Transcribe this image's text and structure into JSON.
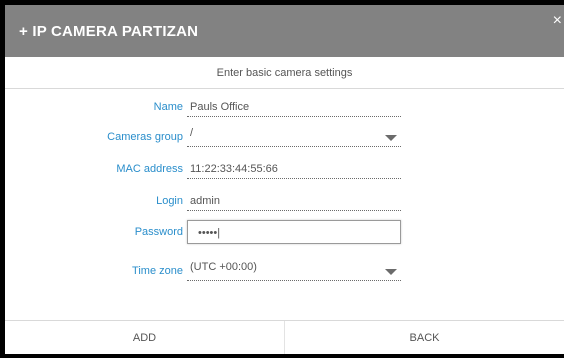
{
  "dialog": {
    "title": "+ IP CAMERA PARTIZAN",
    "subtitle": "Enter basic camera settings",
    "close_icon": "×"
  },
  "fields": {
    "name": {
      "label": "Name",
      "value": "Pauls Office"
    },
    "cameras_group": {
      "label": "Cameras group",
      "value": "/"
    },
    "mac_address": {
      "label": "MAC address",
      "value": "11:22:33:44:55:66"
    },
    "login": {
      "label": "Login",
      "value": "admin"
    },
    "password": {
      "label": "Password",
      "value": "•••••|"
    },
    "time_zone": {
      "label": "Time zone",
      "value": "(UTC +00:00)"
    }
  },
  "footer": {
    "add_label": "ADD",
    "back_label": "BACK"
  }
}
